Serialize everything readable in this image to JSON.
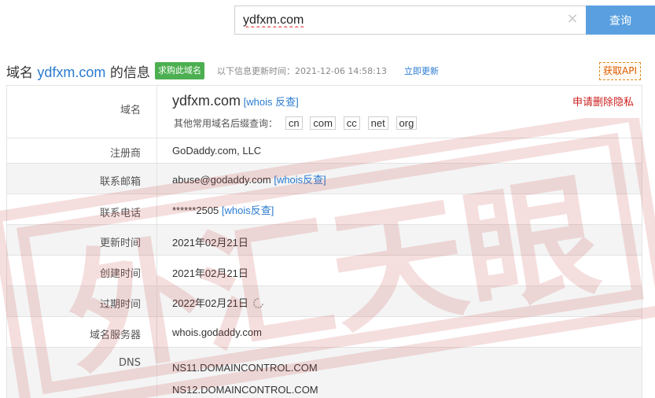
{
  "search": {
    "value": "ydfxm.com",
    "clear_icon": "×",
    "button_label": "查询"
  },
  "header": {
    "prefix": "域名 ",
    "domain": "ydfxm.com",
    "suffix": " 的信息",
    "buy_badge": "求购此域名",
    "update_info": "以下信息更新时间：2021-12-06 14:58:13",
    "update_link": "立即更新",
    "api_button": "获取API"
  },
  "rows": {
    "domain": {
      "label": "域名",
      "value": "ydfxm.com",
      "whois_link": "[whois 反查]",
      "report_link": "申请删除隐私",
      "suffix_label": "其他常用域名后缀查询：",
      "suffixes": [
        "cn",
        "com",
        "cc",
        "net",
        "org"
      ]
    },
    "registrar": {
      "label": "注册商",
      "value": "GoDaddy.com, LLC"
    },
    "email": {
      "label": "联系邮箱",
      "value": "abuse@godaddy.com",
      "link": "[whois反查]"
    },
    "phone": {
      "label": "联系电话",
      "value": "******2505",
      "link": "[whois反查]"
    },
    "updated": {
      "label": "更新时间",
      "value": "2021年02月21日"
    },
    "created": {
      "label": "创建时间",
      "value": "2021年02月21日"
    },
    "expires": {
      "label": "过期时间",
      "value": "2022年02月21日"
    },
    "nameserver": {
      "label": "域名服务器",
      "value": "whois.godaddy.com"
    },
    "dns": {
      "label": "DNS",
      "values": [
        "NS11.DOMAINCONTROL.COM",
        "NS12.DOMAINCONTROL.COM"
      ]
    }
  },
  "watermark": {
    "text": "外汇天眼",
    "color": "#c83a3a"
  },
  "colors": {
    "link": "#2a7bd1",
    "badge": "#4caf50",
    "search_button": "#5aa0e0",
    "alert": "#cc2020"
  }
}
